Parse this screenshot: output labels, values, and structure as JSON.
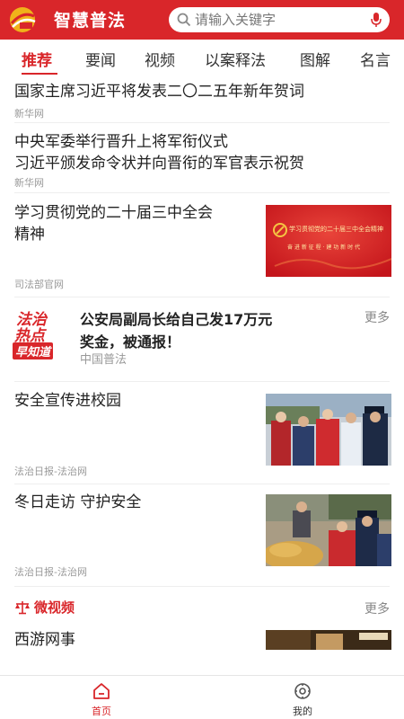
{
  "header": {
    "app_title": "智慧普法",
    "search_placeholder": "请输入关键字",
    "colors": {
      "primary": "#d9262a",
      "header_text": "#ffffff"
    }
  },
  "tabs": [
    {
      "label": "推荐",
      "active": true
    },
    {
      "label": "要闻"
    },
    {
      "label": "视频"
    },
    {
      "label": "以案释法"
    },
    {
      "label": "图解"
    },
    {
      "label": "名言"
    }
  ],
  "feed": {
    "items": [
      {
        "title": "国家主席习近平将发表二〇二五年新年贺词",
        "source": "新华网"
      },
      {
        "title_lines": [
          "中央军委举行晋升上将军衔仪式",
          "习近平颁发命令状并向晋衔的军官表示祝贺"
        ],
        "source": "新华网"
      },
      {
        "title_lines": [
          "学习贯彻党的二十届三中全会",
          "精神"
        ],
        "source": "司法部官网",
        "thumb": {
          "icon": "party-emblem-icon",
          "line1": "学习贯彻党的二十届三中全会精神",
          "line2": "奋 进 新 征 程 · 建 功 新 时 代"
        }
      },
      {
        "type": "promo",
        "logo_lines": [
          "法治",
          "热点",
          "早知道"
        ],
        "title_lines": [
          "公安局副局长给自己发17万元",
          "奖金，被通报！"
        ],
        "source": "中国普法",
        "more_label": "更多"
      },
      {
        "title": "安全宣传进校园",
        "source": "法治日报-法治网",
        "thumb": {
          "icon": "police-school-photo"
        }
      },
      {
        "title": "冬日走访 守护安全",
        "source": "法治日报-法治网",
        "thumb": {
          "icon": "police-visit-photo"
        }
      }
    ]
  },
  "micro_video": {
    "title": "微视频",
    "more_label": "更多",
    "items": [
      {
        "title": "西游网事",
        "thumb": {
          "icon": "video-still-photo"
        }
      }
    ]
  },
  "bottom_nav": [
    {
      "label": "首页",
      "icon": "home-icon",
      "active": true
    },
    {
      "label": "我的",
      "icon": "profile-icon"
    }
  ]
}
